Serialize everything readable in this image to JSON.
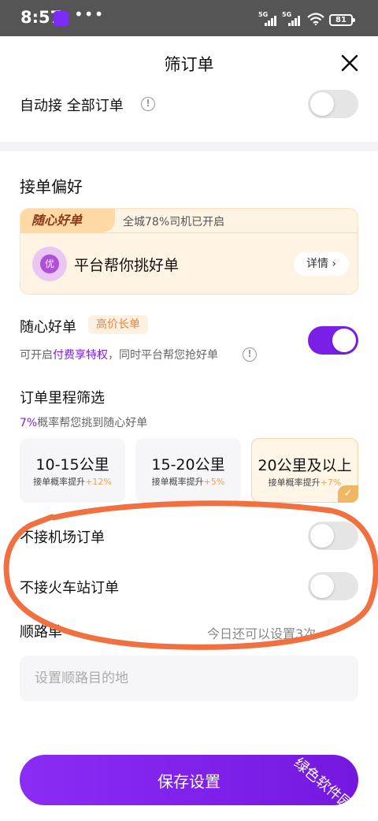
{
  "status_bar": {
    "time": "8:57",
    "dots": "•••",
    "battery": "81",
    "signal_1": "5G",
    "signal_2": "5G"
  },
  "header": {
    "title": "筛订单"
  },
  "auto_accept": {
    "label": "自动接 全部订单",
    "enabled": false
  },
  "preferences": {
    "title": "接单偏好",
    "promo": {
      "brand": "随心好单",
      "ratio_text": "全城78%司机已开启",
      "pick_text": "平台帮你挑好单",
      "details_label": "详情 ›"
    },
    "good_orders": {
      "label": "随心好单",
      "tag": "高价长单",
      "desc_prefix": "可开启",
      "desc_accent": "付费享特权",
      "desc_suffix": "，同时平台帮您抢好单",
      "enabled": true
    },
    "mileage": {
      "title": "订单里程筛选",
      "hint_accent": "7%",
      "hint_rest": "概率帮您挑到随心好单",
      "options": [
        {
          "name": "10-15公里",
          "boost_text": "接单概率提升",
          "boost_value": "+12%",
          "selected": false
        },
        {
          "name": "15-20公里",
          "boost_text": "接单概率提升",
          "boost_value": "+5%",
          "selected": false
        },
        {
          "name": "20公里及以上",
          "boost_text": "接单概率提升",
          "boost_value": "+7%",
          "selected": true
        }
      ]
    },
    "no_airport": {
      "label": "不接机场订单",
      "enabled": false
    },
    "no_train": {
      "label": "不接火车站订单",
      "enabled": false
    },
    "route": {
      "label": "顺路单",
      "hint": "今日还可以设置3次 ›",
      "placeholder": "设置顺路目的地"
    }
  },
  "save_button": {
    "label": "保存设置"
  },
  "watermark": {
    "text": "绿色软件园"
  },
  "colors": {
    "accent": "#7a1fe6",
    "annotation": "#f07040",
    "tag_text": "#e1853a"
  },
  "icons": [
    "close-icon",
    "info-icon",
    "checkmark-icon",
    "wifi-icon",
    "battery-icon"
  ]
}
